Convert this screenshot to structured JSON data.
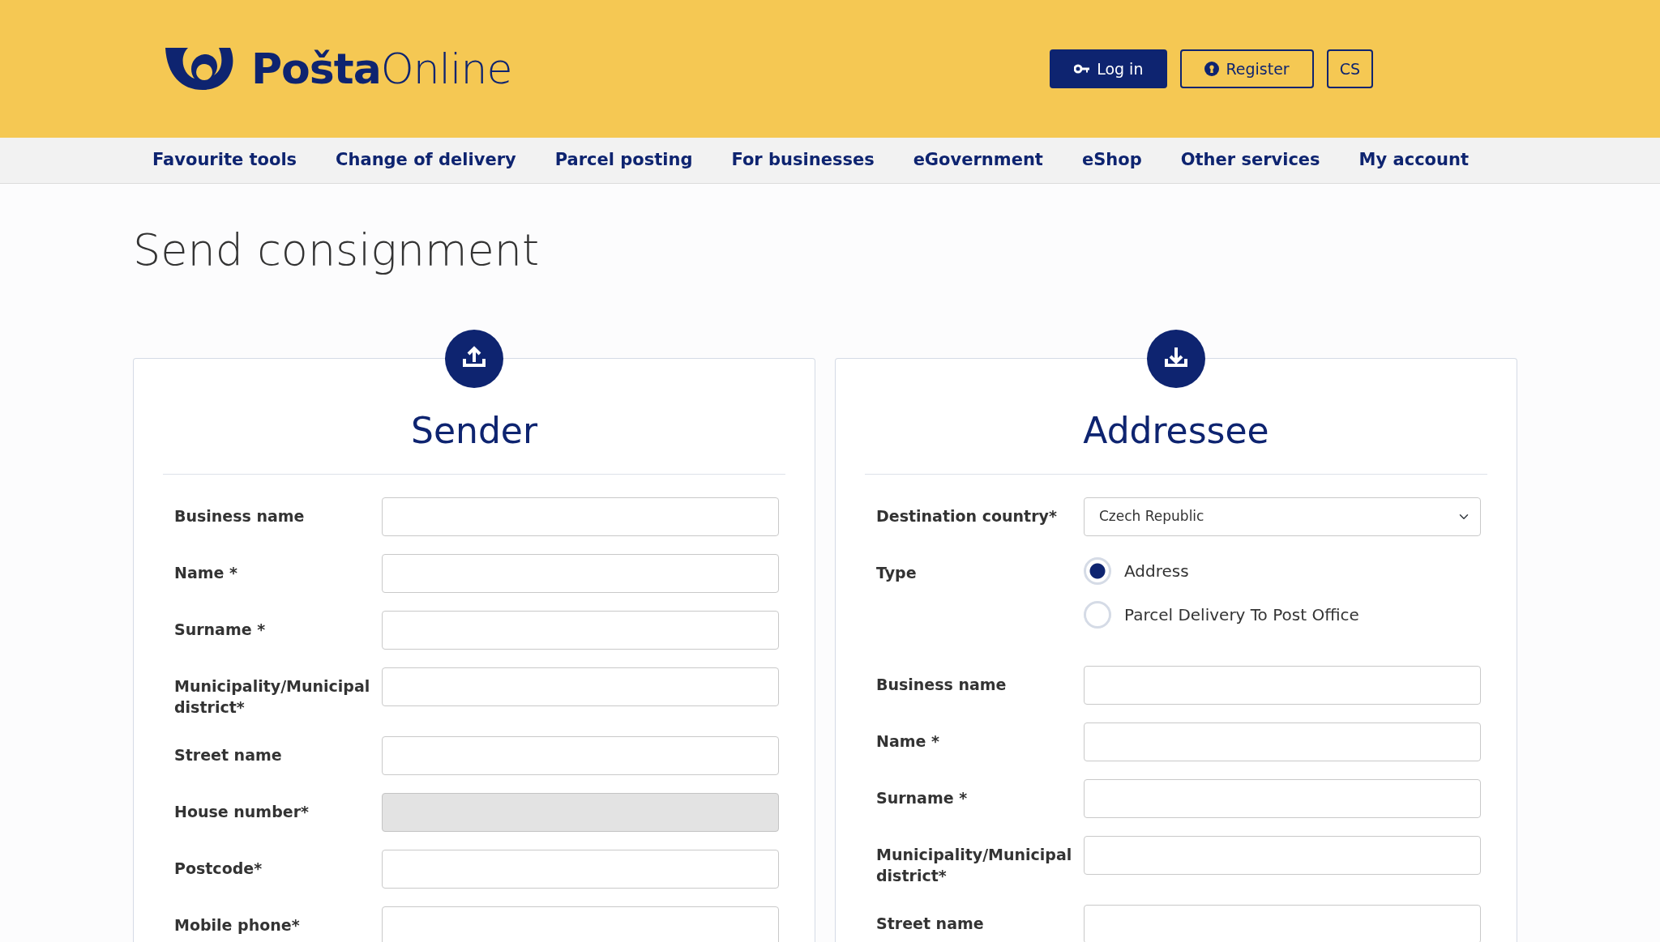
{
  "header": {
    "logo_bold": "Pošta",
    "logo_light": "Online",
    "buttons": [
      {
        "kind": "login",
        "label": "Log in"
      },
      {
        "kind": "register",
        "label": "Register"
      },
      {
        "kind": "language",
        "label": "CS"
      }
    ]
  },
  "nav": [
    "Favourite tools",
    "Change of delivery",
    "Parcel posting",
    "For businesses",
    "eGovernment",
    "eShop",
    "Other services",
    "My account"
  ],
  "page_title": "Send consignment",
  "cards": [
    {
      "kind": "upload",
      "title": "Sender",
      "fields": [
        {
          "kind": "text",
          "label": "Business name",
          "disabled": false
        },
        {
          "kind": "text",
          "label": "Name *",
          "disabled": false
        },
        {
          "kind": "text",
          "label": "Surname *",
          "disabled": false
        },
        {
          "kind": "text",
          "label": "Municipality/Municipal district*",
          "disabled": false
        },
        {
          "kind": "text",
          "label": "Street name",
          "disabled": false
        },
        {
          "kind": "text",
          "label": "House number*",
          "disabled": true
        },
        {
          "kind": "text",
          "label": "Postcode*",
          "disabled": false
        },
        {
          "kind": "text",
          "label": "Mobile phone*",
          "disabled": false
        }
      ]
    },
    {
      "kind": "download",
      "title": "Addressee",
      "fields": [
        {
          "kind": "select",
          "label": "Destination country*",
          "value": "Czech Republic"
        },
        {
          "kind": "radio",
          "label": "Type",
          "options": [
            {
              "label": "Address",
              "selected": true
            },
            {
              "label": "Parcel Delivery To Post Office",
              "selected": false
            }
          ]
        },
        {
          "kind": "text",
          "label": "Business name",
          "disabled": false
        },
        {
          "kind": "text",
          "label": "Name *",
          "disabled": false
        },
        {
          "kind": "text",
          "label": "Surname *",
          "disabled": false
        },
        {
          "kind": "text",
          "label": "Municipality/Municipal district*",
          "disabled": false
        },
        {
          "kind": "text",
          "label": "Street name",
          "disabled": false
        }
      ]
    }
  ]
}
